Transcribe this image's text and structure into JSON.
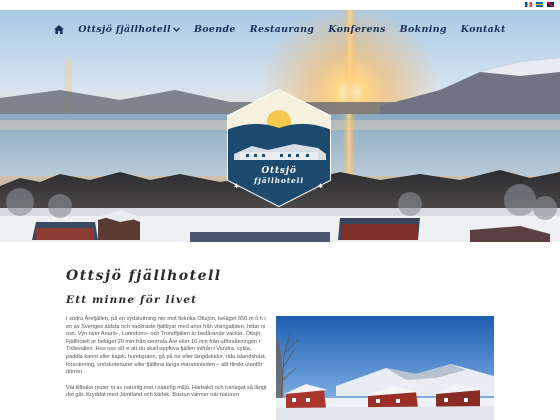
{
  "languages": [
    {
      "code": "fr",
      "colors": [
        "#0055a4",
        "#ffffff",
        "#ef4135"
      ]
    },
    {
      "code": "sv",
      "colors": [
        "#006aa7",
        "#fecc00"
      ]
    },
    {
      "code": "en",
      "colors": [
        "#012169",
        "#c8102e"
      ]
    }
  ],
  "nav": {
    "home_icon": "home-icon",
    "items": [
      {
        "label": "Ottsjö fjällhotell",
        "has_dropdown": true
      },
      {
        "label": "Boende"
      },
      {
        "label": "Restaurang"
      },
      {
        "label": "Konferens"
      },
      {
        "label": "Bokning"
      },
      {
        "label": "Kontakt"
      }
    ]
  },
  "logo": {
    "line1": "Ottsjö",
    "line2": "fjällhotell"
  },
  "page": {
    "title": "Ottsjö fjällhotell",
    "subtitle": "Ett minne för livet",
    "paragraphs": [
      "I södra Årefjällen, på en sydsluttning ner mot fiskrika Ottsjön, beläget 550 m ö.h i en av Sveriges äldsta och vackraste fjällbyar med anor från vikingatiden, hittar ni oss. Vyn över Anaris-, Lunndörrs- och Trondfjällen är bedårande vacker. Ottsjö Fjällhotell är beläget 20 min från centrala Åre eller 10 min från utförsåkningen i Trillevallen. Hos oss vill vi att du skall uppleva fjällen inifrån i Vandra, cykla, paddla kanot eller kajak, hundspann, gå på tur eller längdskidor, rida islandshäst, forsränning, snöskoterturer eller fjällbrai längs maratonleden – allt direkt utanför dörren.",
      "Väl tillbaka ryuter ni av naturlig mat i naturlig miljö. Härbakö och härlagat så långt det går. Kryddat med Jämtland och kärlek. Bastun värmer när naturen"
    ]
  },
  "colors": {
    "nav_text": "#1d2f5c",
    "heading_text": "#2a2a2a",
    "body_text": "#555555",
    "logo_navy": "#1e4a6e",
    "logo_sun": "#f2c94c"
  }
}
